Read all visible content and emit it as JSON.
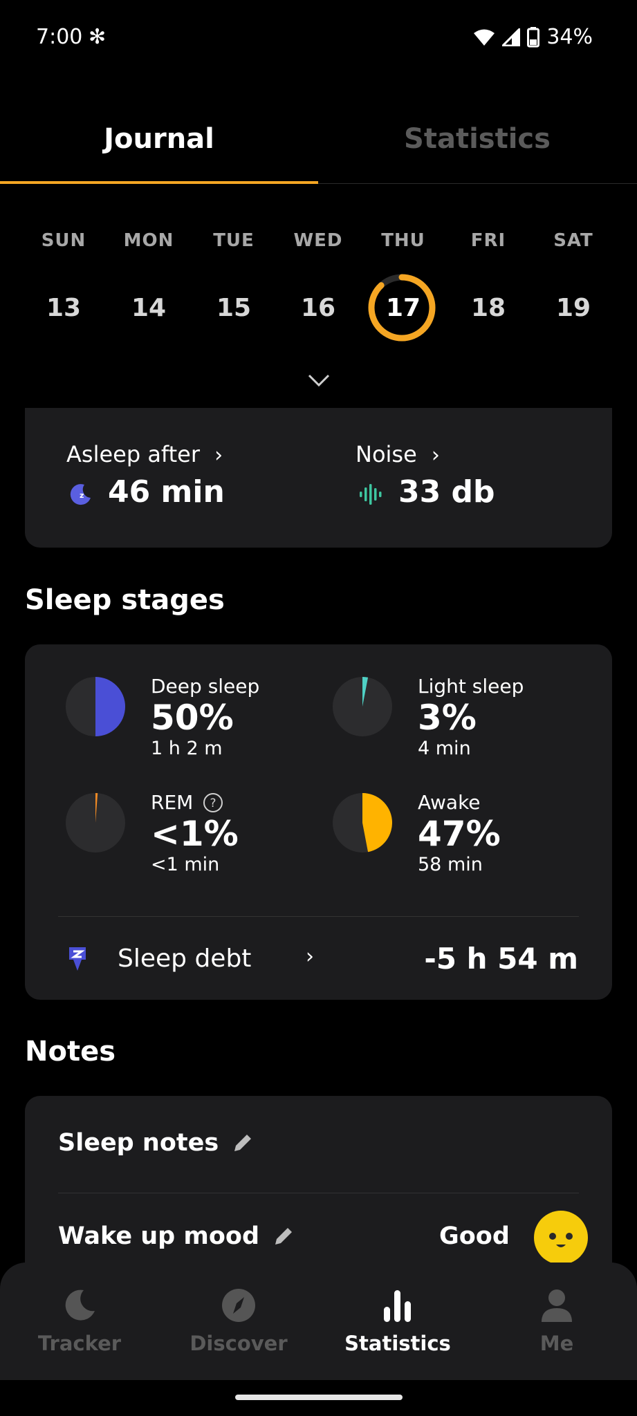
{
  "status_bar": {
    "time": "7:00",
    "battery": "34%"
  },
  "tabs": [
    {
      "label": "Journal",
      "active": true
    },
    {
      "label": "Statistics",
      "active": false
    }
  ],
  "week": {
    "days": [
      {
        "name": "SUN",
        "num": "13"
      },
      {
        "name": "MON",
        "num": "14"
      },
      {
        "name": "TUE",
        "num": "15"
      },
      {
        "name": "WED",
        "num": "16"
      },
      {
        "name": "THU",
        "num": "17",
        "selected": true
      },
      {
        "name": "FRI",
        "num": "18"
      },
      {
        "name": "SAT",
        "num": "19"
      }
    ],
    "selected_progress": 0.88
  },
  "summary": {
    "asleep_after": {
      "label": "Asleep after",
      "value": "46 min"
    },
    "noise": {
      "label": "Noise",
      "value": "33 db"
    }
  },
  "sleep_stages": {
    "title": "Sleep stages",
    "items": [
      {
        "name": "Deep sleep",
        "pct": "50%",
        "time": "1 h 2 m",
        "fraction": 0.5,
        "color": "#4a4fd6"
      },
      {
        "name": "Light sleep",
        "pct": "3%",
        "time": "4 min",
        "fraction": 0.03,
        "color": "#4fd1c5"
      },
      {
        "name": "REM",
        "pct": "<1%",
        "time": "<1 min",
        "fraction": 0.005,
        "color": "#f08a24"
      },
      {
        "name": "Awake",
        "pct": "47%",
        "time": "58 min",
        "fraction": 0.47,
        "color": "#ffb300"
      }
    ],
    "sleep_debt": {
      "label": "Sleep debt",
      "value": "-5 h 54 m"
    }
  },
  "notes": {
    "title": "Notes",
    "sleep_notes_label": "Sleep notes",
    "wake_mood_label": "Wake up mood",
    "wake_mood_value": "Good"
  },
  "nav": [
    {
      "label": "Tracker",
      "icon": "moon-icon",
      "active": false
    },
    {
      "label": "Discover",
      "icon": "compass-icon",
      "active": false
    },
    {
      "label": "Statistics",
      "icon": "bar-chart-icon",
      "active": true
    },
    {
      "label": "Me",
      "icon": "person-icon",
      "active": false
    }
  ],
  "colors": {
    "accent": "#f5a623",
    "card": "#1c1c1e",
    "deep": "#4a4fd6",
    "noise": "#3ec6a0"
  }
}
